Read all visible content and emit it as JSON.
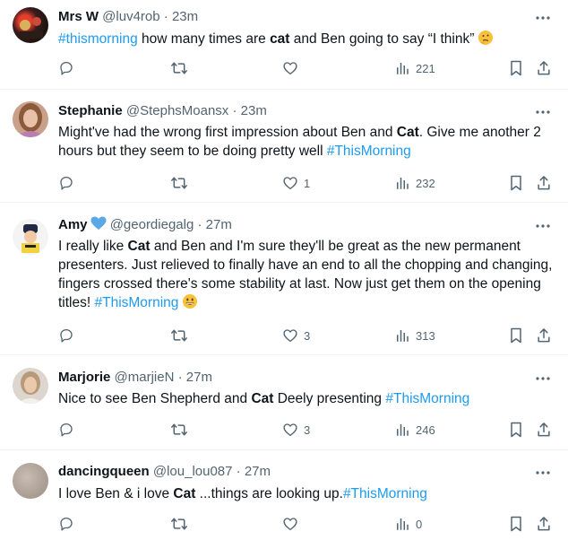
{
  "tweets": [
    {
      "name": "Mrs W",
      "handle": "@luv4rob",
      "dot": "·",
      "time": "23m",
      "text": [
        {
          "t": "#thismorning",
          "k": "tag"
        },
        {
          "t": " how many times are ",
          "k": ""
        },
        {
          "t": "cat",
          "k": "kw"
        },
        {
          "t": " and Ben going to say “I think”",
          "k": ""
        }
      ],
      "emoji": "thinking-face",
      "replies": "",
      "retweets": "",
      "likes": "",
      "views": "221"
    },
    {
      "name": "Stephanie",
      "handle": "@StephsMoansx",
      "dot": "·",
      "time": "23m",
      "text": [
        {
          "t": "Might've had the wrong first impression about Ben and ",
          "k": ""
        },
        {
          "t": "Cat",
          "k": "kw"
        },
        {
          "t": ". Give me another 2 hours but they seem to be doing pretty well ",
          "k": ""
        },
        {
          "t": "#ThisMorning",
          "k": "tag"
        }
      ],
      "emoji": "",
      "replies": "",
      "retweets": "",
      "likes": "1",
      "views": "232"
    },
    {
      "name": "Amy",
      "handle": "@geordiegalg",
      "dot": "·",
      "time": "27m",
      "badge": "blue-heart",
      "text": [
        {
          "t": "I really like ",
          "k": ""
        },
        {
          "t": "Cat",
          "k": "kw"
        },
        {
          "t": " and Ben and I'm sure they'll be great as the new permanent presenters. Just relieved to finally have an end to all the chopping and changing, fingers crossed there's some stability at last. Now just get them on the opening titles! ",
          "k": ""
        },
        {
          "t": "#ThisMorning",
          "k": "tag"
        }
      ],
      "emoji": "grinning-face",
      "replies": "",
      "retweets": "",
      "likes": "3",
      "views": "313"
    },
    {
      "name": "Marjorie",
      "handle": "@marjieN",
      "dot": "·",
      "time": "27m",
      "text": [
        {
          "t": "Nice to see Ben Shepherd and ",
          "k": ""
        },
        {
          "t": "Cat",
          "k": "kw"
        },
        {
          "t": " Deely presenting ",
          "k": ""
        },
        {
          "t": "#ThisMorning",
          "k": "tag"
        }
      ],
      "emoji": "",
      "replies": "",
      "retweets": "",
      "likes": "3",
      "views": "246"
    },
    {
      "name": "dancingqueen",
      "handle": "@lou_lou087",
      "dot": "·",
      "time": "27m",
      "text": [
        {
          "t": "I love Ben & i love ",
          "k": ""
        },
        {
          "t": "Cat",
          "k": "kw"
        },
        {
          "t": " ...things are looking up.",
          "k": ""
        },
        {
          "t": "#ThisMorning",
          "k": "tag"
        }
      ],
      "emoji": "",
      "replies": "",
      "retweets": "",
      "likes": "",
      "views": "0"
    }
  ],
  "icons": {
    "reply": "reply-icon",
    "retweet": "retweet-icon",
    "like": "heart-icon",
    "views": "views-icon",
    "bookmark": "bookmark-icon",
    "share": "share-icon",
    "more": "more-icon"
  },
  "colors": {
    "link": "#1d9bf0",
    "muted": "#536471",
    "text": "#0f1419",
    "divider": "#eff3f4"
  }
}
